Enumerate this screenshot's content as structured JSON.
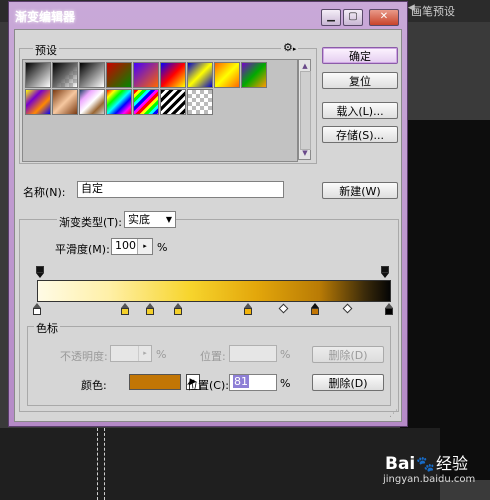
{
  "background": {
    "brush_arrow": "◀◀",
    "brush_panel_tab": "画笔预设"
  },
  "watermark": {
    "logo_text_left": "Bai",
    "logo_paw": "🐾",
    "logo_text_right": "经验",
    "url": "jingyan.baidu.com"
  },
  "window": {
    "title": "渐变编辑器",
    "minimize": "▁",
    "maximize": "▢",
    "close": "✕"
  },
  "presets": {
    "label": "预设",
    "menu_icon": "gear-icon",
    "swatches": [
      {
        "name": "black-white",
        "bg": "linear-gradient(135deg,#000,#fff)"
      },
      {
        "name": "black-transparent",
        "bg": "linear-gradient(135deg,#000 0%,#666 50%,rgba(255,255,255,0) 100%),repeating-conic-gradient(#ccc 0 25%,#fff 0 50%) 0 0/8px 8px"
      },
      {
        "name": "black-white-2",
        "bg": "linear-gradient(135deg,#000,#fff)"
      },
      {
        "name": "red-green",
        "bg": "linear-gradient(135deg,#c00,#080)"
      },
      {
        "name": "violet-orange",
        "bg": "linear-gradient(135deg,#40f,#f60)"
      },
      {
        "name": "blue-red-yellow",
        "bg": "linear-gradient(135deg,#00f,#f00,#ff0)"
      },
      {
        "name": "blue-yellow-blue",
        "bg": "linear-gradient(135deg,#00c,#ff0,#00c)"
      },
      {
        "name": "orange-yellow-orange",
        "bg": "linear-gradient(135deg,#f60,#ff0,#f60)"
      },
      {
        "name": "violet-green-orange",
        "bg": "linear-gradient(135deg,#70c,#0a0,#f90)"
      },
      {
        "name": "yellow-violet-orange-blue",
        "bg": "linear-gradient(135deg,#ff0,#70c,#f80,#00f)"
      },
      {
        "name": "copper",
        "bg": "linear-gradient(135deg,#7a3a12,#f6c8a0,#7a3a12)"
      },
      {
        "name": "chrome",
        "bg": "linear-gradient(135deg,#246,#eaf,#fff,#963,#ccc)"
      },
      {
        "name": "spectrum",
        "bg": "linear-gradient(135deg,#f00,#ff0,#0f0,#0ff,#00f,#f0f,#f00)"
      },
      {
        "name": "transparent-rainbow",
        "bg": "repeating-linear-gradient(135deg,#f00 0 3px,#ff0 3px 6px,#0f0 6px 9px,#0ff 9px 12px,#00f 12px 15px,#f0f 15px 18px)"
      },
      {
        "name": "transparent-stripes",
        "bg": "repeating-linear-gradient(135deg,#000 0 3px,#fff 3px 6px)"
      },
      {
        "name": "neutral-density",
        "bg": "linear-gradient(135deg,rgba(0,0,0,0),rgba(0,0,0,0)),repeating-conic-gradient(#bbb 0 25%,#fff 0 50%) 0 0/8px 8px"
      }
    ]
  },
  "buttons": {
    "ok": "确定",
    "reset": "复位",
    "load": "载入(L)...",
    "save": "存储(S)...",
    "new": "新建(W)",
    "delete_opacity": "删除(D)",
    "delete_color": "删除(D)"
  },
  "name_field": {
    "label": "名称(N):",
    "value": "自定"
  },
  "gradient": {
    "type_label": "渐变类型(T):",
    "type_value": "实底",
    "smoothness_label": "平滑度(M):",
    "smoothness_value": "100",
    "smoothness_unit": "%"
  },
  "stops_group": {
    "label": "色标",
    "opacity_label": "不透明度:",
    "opacity_unit": "%",
    "opacity_location_label": "位置:",
    "opacity_location_unit": "%",
    "color_label": "颜色:",
    "color_value_hex": "#c27605",
    "color_menu_arrow": "▶",
    "color_location_label": "位置(C):",
    "color_location_value": "81",
    "color_location_unit": "%"
  },
  "color_stops": [
    {
      "location_pct": 0,
      "color": "#ffffff",
      "selected": false
    },
    {
      "location_pct": 25,
      "color": "#f4d02a",
      "selected": false
    },
    {
      "location_pct": 32,
      "color": "#f4d02a",
      "selected": false
    },
    {
      "location_pct": 40,
      "color": "#f4d02a",
      "selected": false
    },
    {
      "location_pct": 60,
      "color": "#f2b40c",
      "selected": false
    },
    {
      "location_pct": 79,
      "color": "#c27605",
      "selected": true
    },
    {
      "location_pct": 100,
      "color": "#000000",
      "selected": false
    }
  ],
  "opacity_stops": [
    {
      "location_pct": 0,
      "opacity": 100
    },
    {
      "location_pct": 100,
      "opacity": 100
    }
  ],
  "midpoints_pct": [
    70,
    88
  ]
}
